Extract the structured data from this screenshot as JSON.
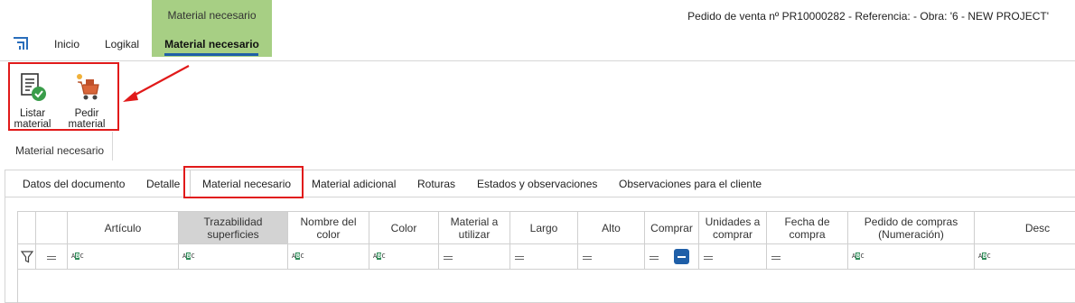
{
  "menu": {
    "inicio": "Inicio",
    "logikal": "Logikal",
    "context_group_title": "Material necesario",
    "context_tab": "Material necesario"
  },
  "document_title": "Pedido de venta nº PR10000282 - Referencia:  - Obra: '6 - NEW PROJECT'",
  "ribbon": {
    "listar_label": "Listar\nmaterial",
    "pedir_label": "Pedir\nmaterial",
    "group_label": "Material necesario"
  },
  "tabs": [
    "Datos del documento",
    "Detalle",
    "Material necesario",
    "Material adicional",
    "Roturas",
    "Estados y observaciones",
    "Observaciones para el cliente"
  ],
  "grid": {
    "columns": [
      "Artículo",
      "Trazabilidad\nsuperficies",
      "Nombre del\ncolor",
      "Color",
      "Material a\nutilizar",
      "Largo",
      "Alto",
      "Comprar",
      "Unidades a\ncomprar",
      "Fecha de\ncompra",
      "Pedido de compras\n(Numeración)",
      "Desc"
    ],
    "filter_types": [
      "text",
      "text",
      "text",
      "text",
      "equals",
      "equals",
      "equals",
      "toggle",
      "equals",
      "equals",
      "text",
      "text"
    ],
    "text_filter_icon": "abc-text-icon",
    "equals_filter_icon": "equals-icon"
  },
  "colors": {
    "context_tab_bg": "#a7cf84",
    "accent": "#1f5fa8",
    "highlight": "#e11a1a"
  }
}
